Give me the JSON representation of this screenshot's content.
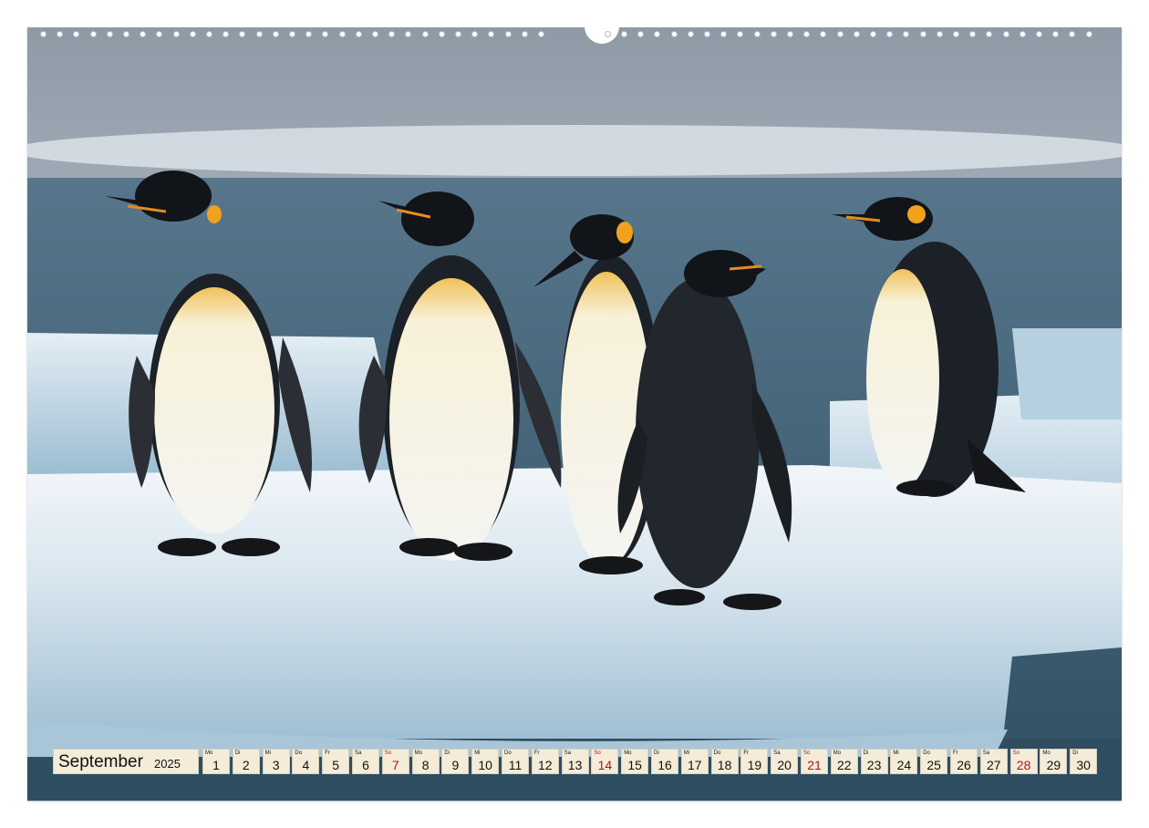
{
  "calendar": {
    "month": "September",
    "year": "2025",
    "days": [
      {
        "wd": "Mo",
        "n": "1"
      },
      {
        "wd": "Di",
        "n": "2"
      },
      {
        "wd": "Mi",
        "n": "3"
      },
      {
        "wd": "Do",
        "n": "4"
      },
      {
        "wd": "Fr",
        "n": "5"
      },
      {
        "wd": "Sa",
        "n": "6"
      },
      {
        "wd": "So",
        "n": "7",
        "sunday": true
      },
      {
        "wd": "Mo",
        "n": "8"
      },
      {
        "wd": "Di",
        "n": "9"
      },
      {
        "wd": "Mi",
        "n": "10"
      },
      {
        "wd": "Do",
        "n": "11"
      },
      {
        "wd": "Fr",
        "n": "12"
      },
      {
        "wd": "Sa",
        "n": "13"
      },
      {
        "wd": "So",
        "n": "14",
        "sunday": true
      },
      {
        "wd": "Mo",
        "n": "15"
      },
      {
        "wd": "Di",
        "n": "16"
      },
      {
        "wd": "Mi",
        "n": "17"
      },
      {
        "wd": "Do",
        "n": "18"
      },
      {
        "wd": "Fr",
        "n": "19"
      },
      {
        "wd": "Sa",
        "n": "20"
      },
      {
        "wd": "So",
        "n": "21",
        "sunday": true
      },
      {
        "wd": "Mo",
        "n": "22"
      },
      {
        "wd": "Di",
        "n": "23"
      },
      {
        "wd": "Mi",
        "n": "24"
      },
      {
        "wd": "Do",
        "n": "25"
      },
      {
        "wd": "Fr",
        "n": "26"
      },
      {
        "wd": "Sa",
        "n": "27"
      },
      {
        "wd": "So",
        "n": "28",
        "sunday": true
      },
      {
        "wd": "Mo",
        "n": "29"
      },
      {
        "wd": "Di",
        "n": "30"
      }
    ]
  },
  "colors": {
    "sunday": "#b3121c",
    "cell_bg": "#f4ecd8"
  },
  "photo": {
    "subject_icon": "penguin-icon"
  }
}
